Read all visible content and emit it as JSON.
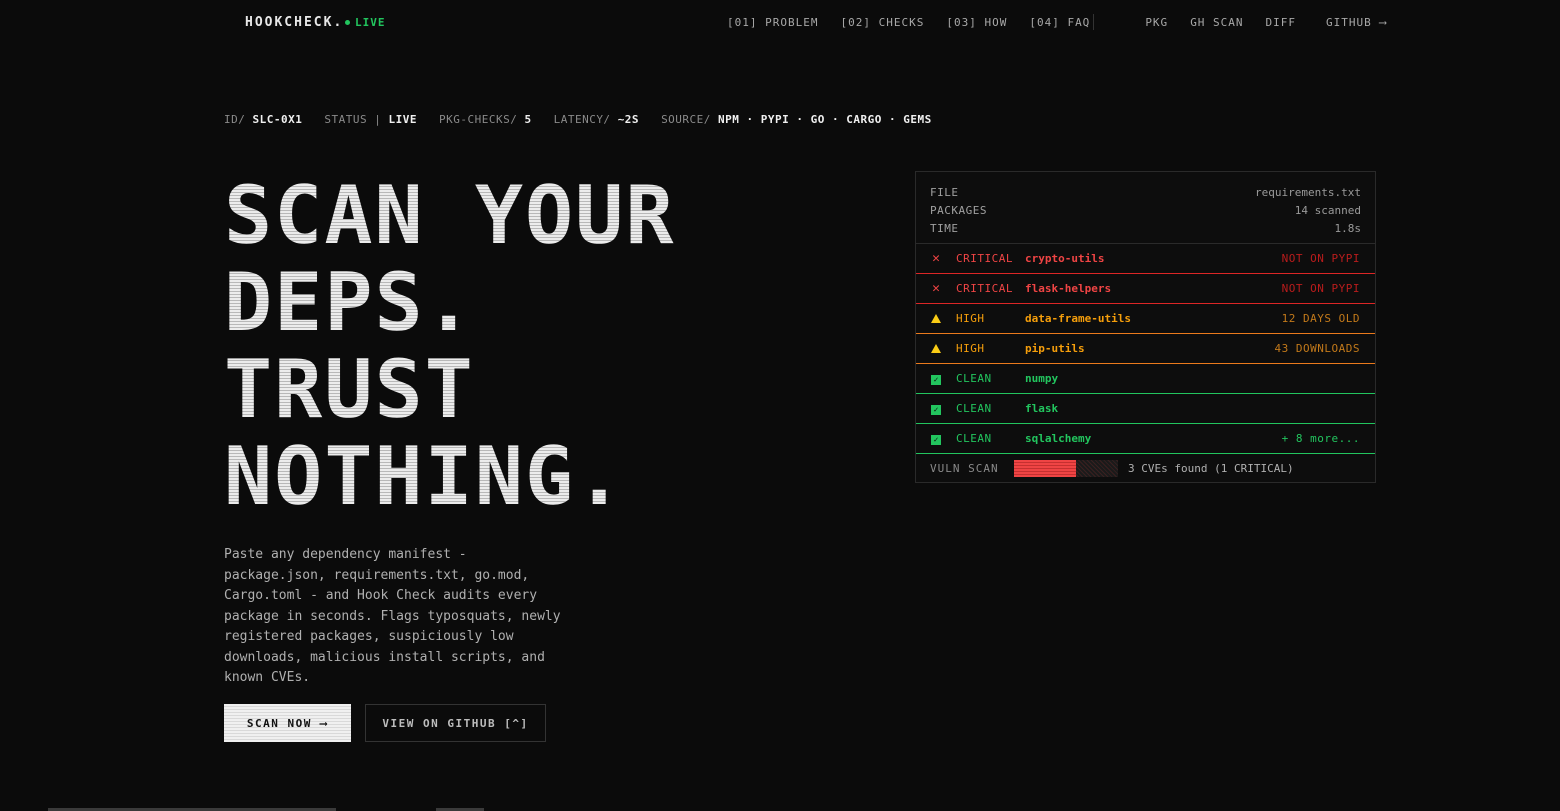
{
  "nav": {
    "brand": "HOOKCHECK.",
    "live": "LIVE",
    "links": [
      "[01] PROBLEM",
      "[02] CHECKS",
      "[03] HOW",
      "[04] FAQ"
    ],
    "tools": [
      "PKG",
      "GH SCAN",
      "DIFF",
      "GITHUB ⟶"
    ]
  },
  "meta": {
    "id_label": "ID/",
    "id_value": "SLC-0X1",
    "status_label": "STATUS |",
    "status_value": "LIVE",
    "checks_label": "PKG-CHECKS/",
    "checks_value": "5",
    "latency_label": "LATENCY/",
    "latency_value": "~2S",
    "source_label": "SOURCE/",
    "source_value": "NPM · PYPI · GO · CARGO · GEMS"
  },
  "hero": {
    "lines": [
      "SCAN YOUR",
      "DEPS.",
      "TRUST",
      "NOTHING."
    ],
    "description": "Paste any dependency manifest - package.json, requirements.txt, go.mod, Cargo.toml - and Hook Check audits every package in seconds. Flags typosquats, newly registered packages, suspiciously low downloads, malicious install scripts, and known CVEs.",
    "primary_button": "SCAN NOW ⟶",
    "secondary_button": "VIEW ON GITHUB [^]"
  },
  "panel": {
    "file_label": "FILE",
    "file_value": "requirements.txt",
    "packages_label": "PACKAGES",
    "packages_value": "14 scanned",
    "time_label": "TIME",
    "time_value": "1.8s",
    "rows": [
      {
        "icon": "x-icon",
        "severity": "CRITICAL",
        "name": "crypto-utils",
        "note": "NOT ON PYPI"
      },
      {
        "icon": "x-icon",
        "severity": "CRITICAL",
        "name": "flask-helpers",
        "note": "NOT ON PYPI"
      },
      {
        "icon": "warning-icon",
        "severity": "HIGH",
        "name": "data-frame-utils",
        "note": "12 DAYS OLD"
      },
      {
        "icon": "warning-icon",
        "severity": "HIGH",
        "name": "pip-utils",
        "note": "43 DOWNLOADS"
      },
      {
        "icon": "check-icon",
        "severity": "CLEAN",
        "name": "numpy",
        "note": ""
      },
      {
        "icon": "check-icon",
        "severity": "CLEAN",
        "name": "flask",
        "note": ""
      },
      {
        "icon": "check-icon",
        "severity": "CLEAN",
        "name": "sqlalchemy",
        "note": "+ 8 more..."
      }
    ],
    "vuln_label": "VULN SCAN",
    "vuln_progress": 0.6,
    "vuln_text": "3 CVEs found (1 CRITICAL)"
  },
  "colors": {
    "critical": "#ef4444",
    "high": "#f59e0b",
    "clean": "#22c55e",
    "live": "#22c55e"
  }
}
